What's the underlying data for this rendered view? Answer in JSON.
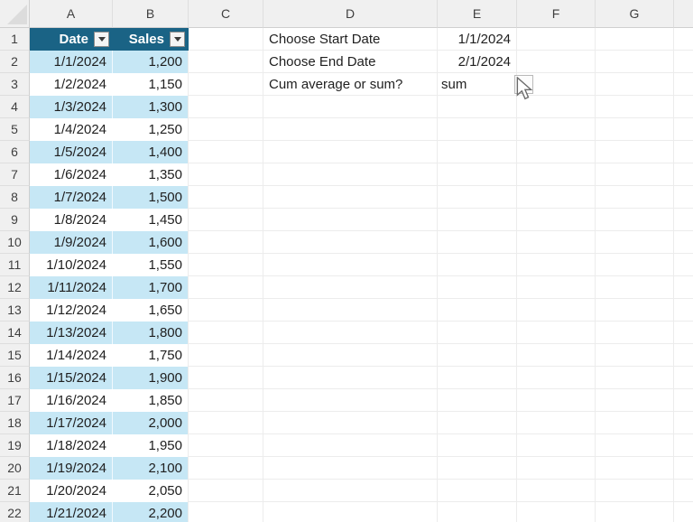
{
  "grid": {
    "column_letters": [
      "A",
      "B",
      "C",
      "D",
      "E",
      "F",
      "G"
    ],
    "row_numbers": [
      "1",
      "2",
      "3",
      "4",
      "5",
      "6",
      "7",
      "8",
      "9",
      "10",
      "11",
      "12",
      "13",
      "14",
      "15",
      "16",
      "17",
      "18",
      "19",
      "20",
      "21",
      "22"
    ]
  },
  "sales_table": {
    "header": {
      "date_label": "Date",
      "sales_label": "Sales"
    },
    "rows": [
      {
        "date": "1/1/2024",
        "sales": "1,200"
      },
      {
        "date": "1/2/2024",
        "sales": "1,150"
      },
      {
        "date": "1/3/2024",
        "sales": "1,300"
      },
      {
        "date": "1/4/2024",
        "sales": "1,250"
      },
      {
        "date": "1/5/2024",
        "sales": "1,400"
      },
      {
        "date": "1/6/2024",
        "sales": "1,350"
      },
      {
        "date": "1/7/2024",
        "sales": "1,500"
      },
      {
        "date": "1/8/2024",
        "sales": "1,450"
      },
      {
        "date": "1/9/2024",
        "sales": "1,600"
      },
      {
        "date": "1/10/2024",
        "sales": "1,550"
      },
      {
        "date": "1/11/2024",
        "sales": "1,700"
      },
      {
        "date": "1/12/2024",
        "sales": "1,650"
      },
      {
        "date": "1/13/2024",
        "sales": "1,800"
      },
      {
        "date": "1/14/2024",
        "sales": "1,750"
      },
      {
        "date": "1/15/2024",
        "sales": "1,900"
      },
      {
        "date": "1/16/2024",
        "sales": "1,850"
      },
      {
        "date": "1/17/2024",
        "sales": "2,000"
      },
      {
        "date": "1/18/2024",
        "sales": "1,950"
      },
      {
        "date": "1/19/2024",
        "sales": "2,100"
      },
      {
        "date": "1/20/2024",
        "sales": "2,050"
      },
      {
        "date": "1/21/2024",
        "sales": "2,200"
      }
    ]
  },
  "controls": {
    "start": {
      "label": "Choose Start Date",
      "value": "1/1/2024"
    },
    "end": {
      "label": "Choose End Date",
      "value": "2/1/2024"
    },
    "mode": {
      "label": "Cum average or sum?",
      "value": "sum"
    }
  },
  "icons": {
    "filter_dropdown": "filter-dropdown-icon",
    "select_all_triangle": "select-all-triangle-icon",
    "mouse_cursor": "mouse-cursor-icon",
    "validation_dropdown": "validation-dropdown-outline"
  },
  "colors": {
    "table_header_fill": "#1A6385",
    "table_band_fill": "#C6E7F5",
    "heading_fill": "#F0F0F0",
    "gridline": "#ECECEC",
    "header_text": "#FFFFFF"
  }
}
